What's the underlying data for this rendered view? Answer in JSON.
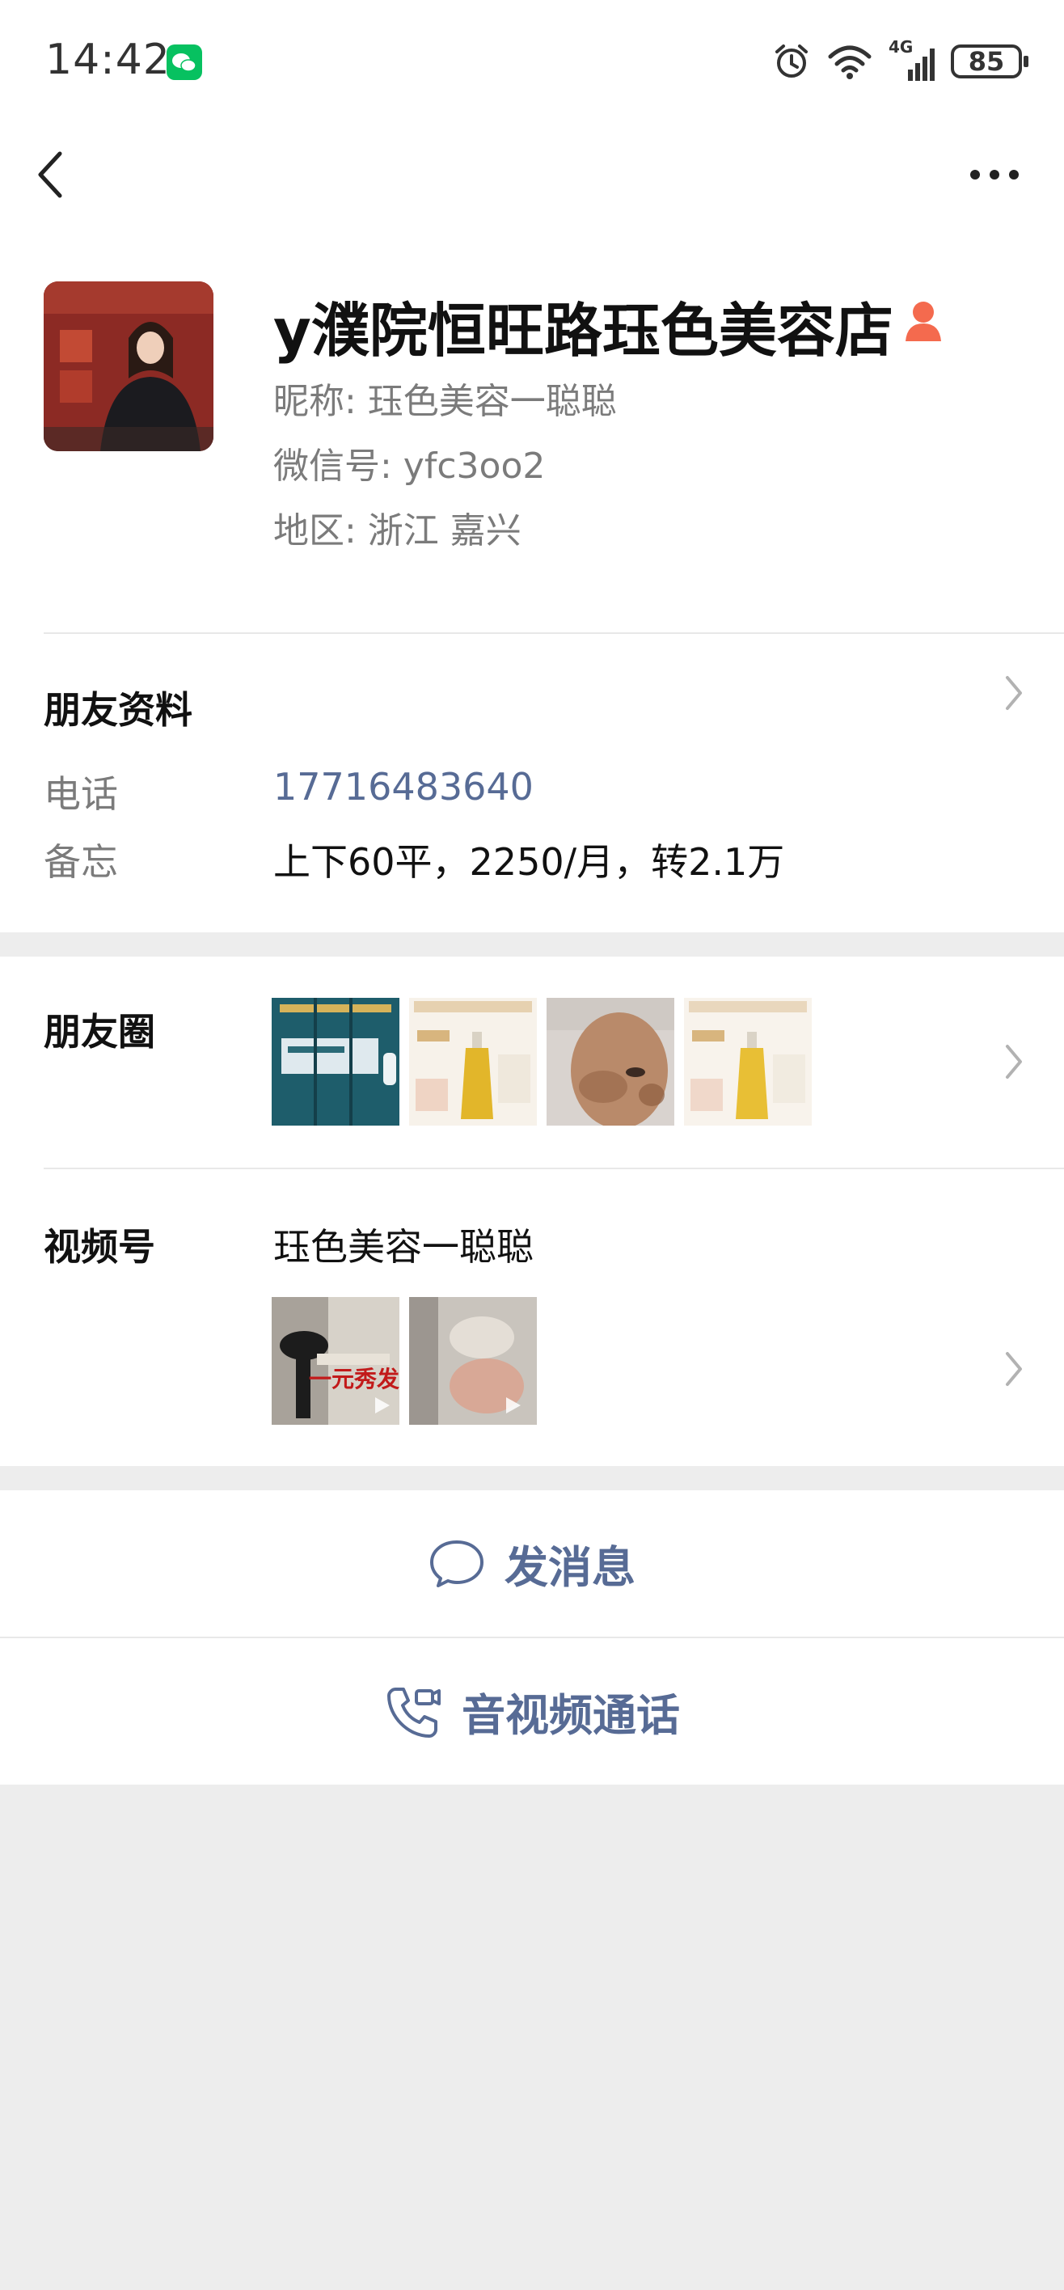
{
  "status_bar": {
    "time": "14:42",
    "network": "4G",
    "battery": "85"
  },
  "profile": {
    "name": "y濮院恒旺路珏色美容店",
    "nickname": "昵称: 珏色美容一聪聪",
    "wechat_id": "微信号: yfc3oo2",
    "region": "地区: 浙江 嘉兴"
  },
  "friend_info": {
    "title": "朋友资料",
    "phone_label": "电话",
    "phone_value": "17716483640",
    "memo_label": "备忘",
    "memo_value": "上下60平，2250/月，转2.1万"
  },
  "moments": {
    "title": "朋友圈",
    "thumbnails": [
      "moment-photo-1",
      "moment-photo-2",
      "moment-photo-3",
      "moment-photo-4"
    ]
  },
  "channels": {
    "title": "视频号",
    "channel_name": "珏色美容一聪聪",
    "video_thumb_text": "一元秀发",
    "video_thumbs": [
      "channel-video-1",
      "channel-video-2"
    ]
  },
  "actions": {
    "message": "发消息",
    "call": "音视频通话"
  },
  "colors": {
    "link_blue": "#576b95",
    "wechat_green": "#07c160",
    "page_gray": "#ededed",
    "person_icon": "#f46a4e"
  },
  "icons": [
    "back-arrow-icon",
    "more-icon",
    "alarm-icon",
    "wifi-icon",
    "signal-icon",
    "chevron-right-icon",
    "chat-bubble-icon",
    "phone-video-icon",
    "person-icon"
  ]
}
